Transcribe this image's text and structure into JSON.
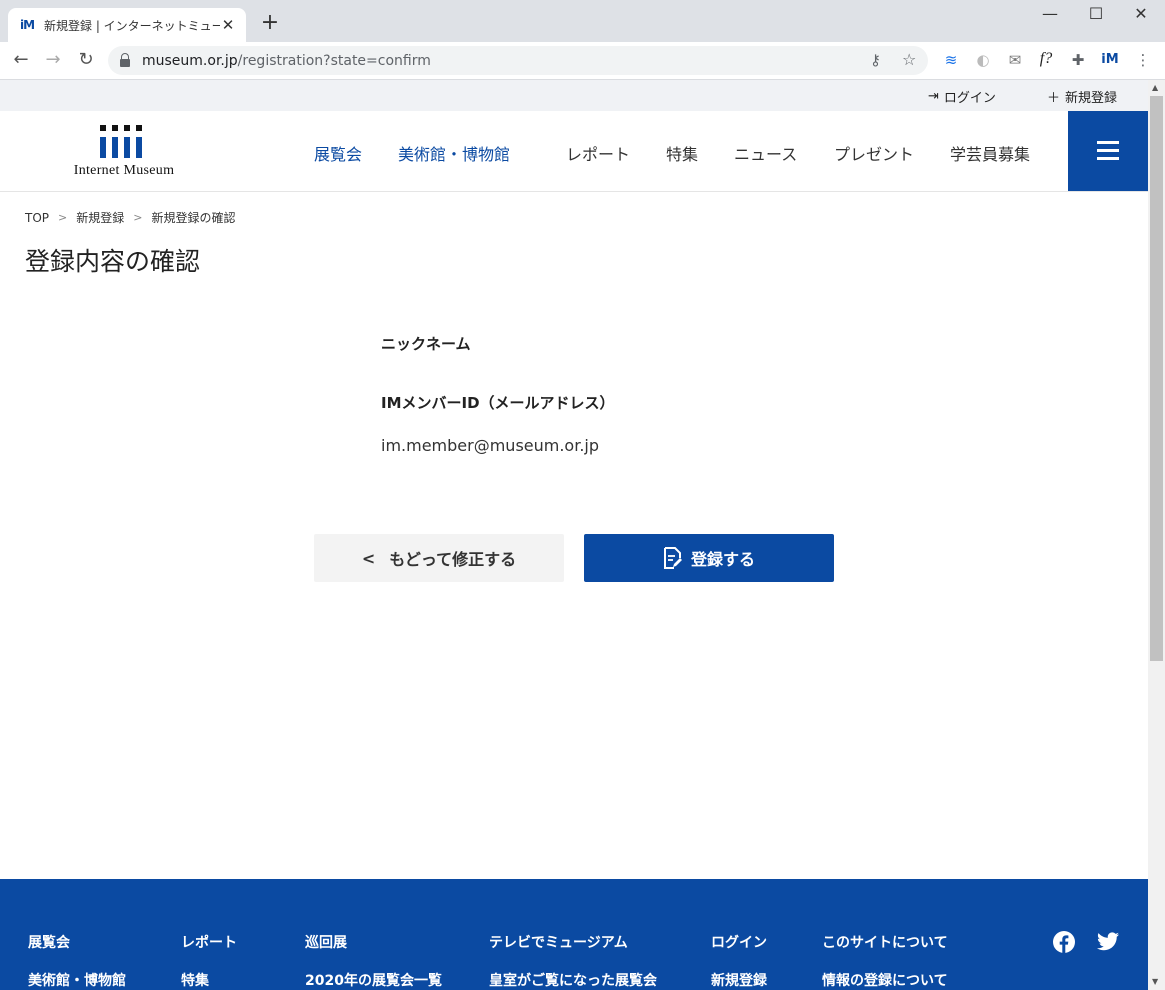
{
  "browser": {
    "tab_title": "新規登録 | インターネットミュージアム",
    "tab_favicon": "iM",
    "close_glyph": "✕",
    "newtab_glyph": "+",
    "url_host": "museum.or.jp",
    "url_path": "/registration?state=confirm",
    "window_controls": [
      "—",
      "☐",
      "✕"
    ],
    "extensions": [
      "key-icon",
      "star-icon",
      "layers-icon",
      "moon-icon",
      "mail-icon",
      "f?",
      "puzzle-icon",
      "iM",
      "more-icon"
    ]
  },
  "utility": {
    "login": "ログイン",
    "register": "新規登録"
  },
  "header": {
    "logo_text": "Internet Museum",
    "nav": [
      "展覧会",
      "美術館・博物館",
      "レポート",
      "特集",
      "ニュース",
      "プレゼント",
      "学芸員募集"
    ]
  },
  "breadcrumb": [
    "TOP",
    "新規登録",
    "新規登録の確認"
  ],
  "page_title": "登録内容の確認",
  "form": {
    "nickname_label": "ニックネーム",
    "member_id_label": "IMメンバーID（メールアドレス）",
    "member_id_value": "im.member@museum.or.jp"
  },
  "buttons": {
    "back": "もどって修正する",
    "submit": "登録する"
  },
  "footer": {
    "col1": [
      "展覧会",
      "美術館・博物館"
    ],
    "col2": [
      "レポート",
      "特集"
    ],
    "col3": [
      "巡回展",
      "2020年の展覧会一覧"
    ],
    "col4": [
      "テレビでミュージアム",
      "皇室がご覧になった展覧会"
    ],
    "col5": [
      "ログイン",
      "新規登録"
    ],
    "col6": [
      "このサイトについて",
      "情報の登録について"
    ]
  },
  "colors": {
    "brand_blue": "#0b4aa2"
  }
}
